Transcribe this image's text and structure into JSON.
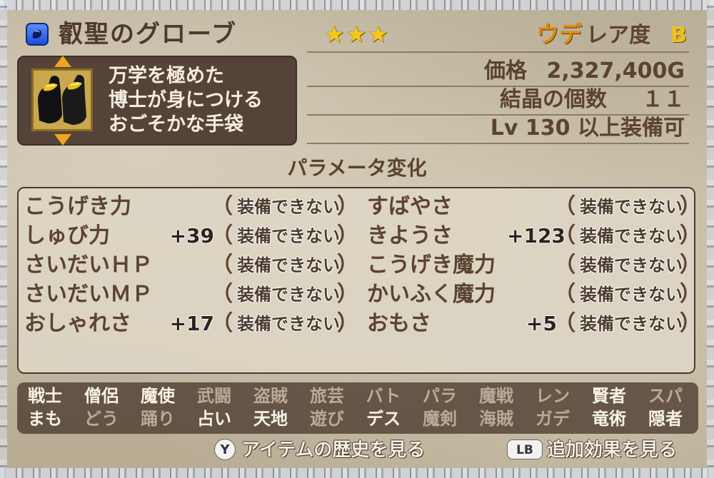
{
  "header": {
    "item_type_icon": "glove-icon",
    "item_name": "叡聖のグローブ",
    "stars": "★★★",
    "rarity_prefix": "ウデ",
    "rarity_label": "レア度",
    "rarity_grade": "B"
  },
  "description": {
    "item_icon": "black-gold-gloves-icon",
    "lines": [
      "万学を極めた",
      "博士が身につける",
      "おごそかな手袋"
    ]
  },
  "stats": {
    "price_label": "価格",
    "price_value": "2,327,400G",
    "crystal_label": "結晶の個数",
    "crystal_value": "１１",
    "level_label": "Lv",
    "level_value": "130",
    "level_suffix": "以上装備可"
  },
  "params": {
    "title": "パラメータ変化",
    "left": [
      {
        "name": "こうげき力",
        "delta": "",
        "note": "装備できない"
      },
      {
        "name": "しゅび力",
        "delta": "+39",
        "note": "装備できない"
      },
      {
        "name": "さいだいＨＰ",
        "delta": "",
        "note": "装備できない"
      },
      {
        "name": "さいだいＭＰ",
        "delta": "",
        "note": "装備できない"
      },
      {
        "name": "おしゃれさ",
        "delta": "+17",
        "note": "装備できない"
      }
    ],
    "right": [
      {
        "name": "すばやさ",
        "delta": "",
        "note": "装備できない"
      },
      {
        "name": "きようさ",
        "delta": "+123",
        "note": "装備できない"
      },
      {
        "name": "こうげき魔力",
        "delta": "",
        "note": "装備できない"
      },
      {
        "name": "かいふく魔力",
        "delta": "",
        "note": "装備できない"
      },
      {
        "name": "おもさ",
        "delta": "+5",
        "note": "装備できない"
      }
    ],
    "open_paren": "（",
    "close_paren": "）"
  },
  "jobs": {
    "row1": [
      {
        "label": "戦士",
        "state": "on"
      },
      {
        "label": "僧侶",
        "state": "on"
      },
      {
        "label": "魔使",
        "state": "on"
      },
      {
        "label": "武闘",
        "state": "off"
      },
      {
        "label": "盗賊",
        "state": "off"
      },
      {
        "label": "旅芸",
        "state": "off"
      },
      {
        "label": "バト",
        "state": "off"
      },
      {
        "label": "パラ",
        "state": "off"
      },
      {
        "label": "魔戦",
        "state": "off"
      },
      {
        "label": "レン",
        "state": "off"
      },
      {
        "label": "賢者",
        "state": "on"
      },
      {
        "label": "スパ",
        "state": "off"
      }
    ],
    "row2": [
      {
        "label": "まも",
        "state": "on"
      },
      {
        "label": "どう",
        "state": "off"
      },
      {
        "label": "踊り",
        "state": "off"
      },
      {
        "label": "占い",
        "state": "on"
      },
      {
        "label": "天地",
        "state": "on"
      },
      {
        "label": "遊び",
        "state": "off"
      },
      {
        "label": "デス",
        "state": "on"
      },
      {
        "label": "魔剣",
        "state": "off"
      },
      {
        "label": "海賊",
        "state": "off"
      },
      {
        "label": "ガデ",
        "state": "off"
      },
      {
        "label": "竜術",
        "state": "on"
      },
      {
        "label": "隠者",
        "state": "on"
      }
    ]
  },
  "footer": {
    "history_button_key": "Y",
    "history_button_label": "アイテムの歴史を見る",
    "effects_button_key": "LB",
    "effects_button_label": "追加効果を見る"
  },
  "colors": {
    "title_text": "#4e3a2a",
    "accent_orange": "#e08a10",
    "star_gold": "#f5c71a",
    "panel_dark": "#55433a"
  }
}
